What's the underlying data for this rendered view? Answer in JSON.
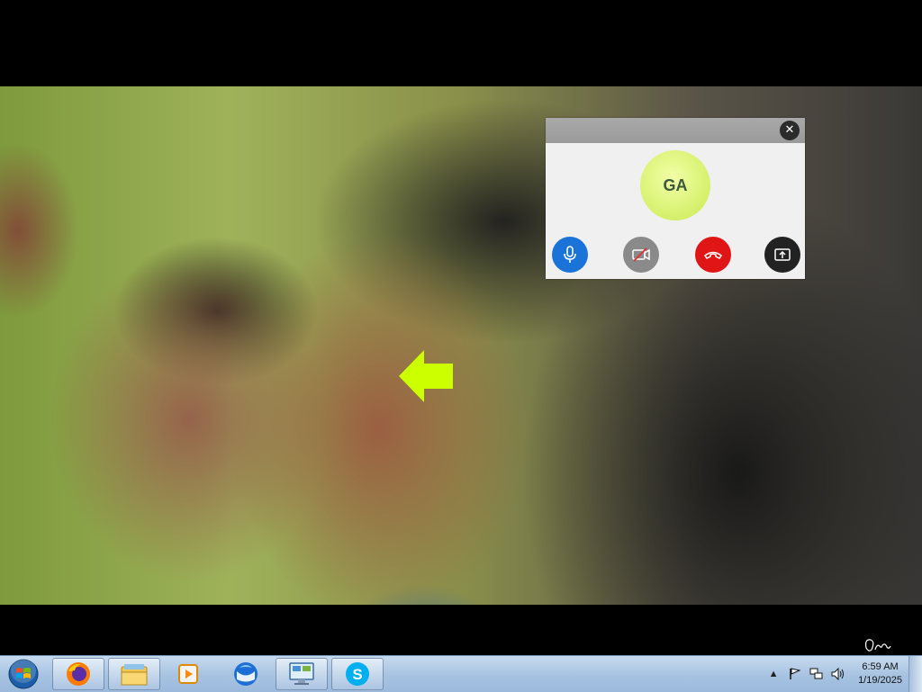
{
  "call": {
    "avatar_initials": "GA",
    "close_glyph": "✕",
    "controls": [
      {
        "name": "microphone",
        "icon": "microphone-icon",
        "color": "#1a73d9"
      },
      {
        "name": "camera-off",
        "icon": "camera-off-icon",
        "color": "#8a8a8a"
      },
      {
        "name": "end-call",
        "icon": "phone-hangup-icon",
        "color": "#e01515"
      },
      {
        "name": "share-screen",
        "icon": "share-screen-icon",
        "color": "#222222"
      }
    ]
  },
  "taskbar": {
    "pinned": [
      "firefox-icon",
      "windows-explorer-icon",
      "media-player-icon",
      "thunderbird-icon",
      "remote-desktop-icon",
      "skype-icon"
    ],
    "clock_time": "6:59 AM",
    "clock_date": "1/19/2025"
  }
}
